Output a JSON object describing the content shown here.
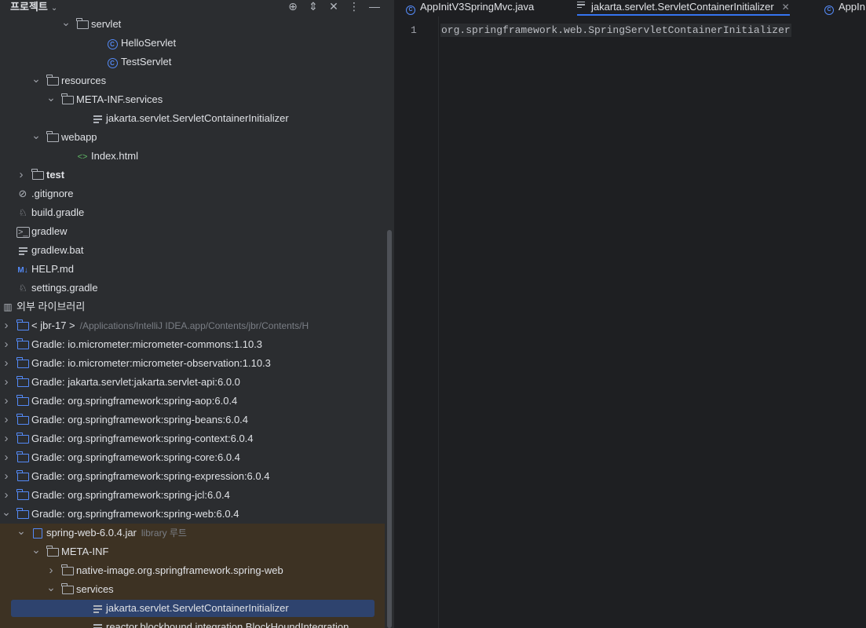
{
  "sidebar": {
    "title": "프로젝트",
    "title_chevron": "⌄",
    "toolbar_icons": [
      "⊕",
      "⇕",
      "✕",
      "⋮",
      "—"
    ]
  },
  "tree": [
    {
      "label": "servlet",
      "level": 7,
      "arrow": "expanded",
      "icon": "package-icon"
    },
    {
      "label": "HelloServlet",
      "level": 9,
      "arrow": "none",
      "icon": "class-icon"
    },
    {
      "label": "TestServlet",
      "level": 9,
      "arrow": "none",
      "icon": "class-icon"
    },
    {
      "label": "resources",
      "level": 5,
      "arrow": "expanded",
      "icon": "resources-folder-icon"
    },
    {
      "label": "META-INF.services",
      "level": 6,
      "arrow": "expanded",
      "icon": "folder-icon"
    },
    {
      "label": "jakarta.servlet.ServletContainerInitializer",
      "level": 8,
      "arrow": "none",
      "icon": "text-file-icon"
    },
    {
      "label": "webapp",
      "level": 5,
      "arrow": "expanded",
      "icon": "folder-icon"
    },
    {
      "label": "Index.html",
      "level": 7,
      "arrow": "none",
      "icon": "html-icon"
    },
    {
      "label": "test",
      "level": 4,
      "arrow": "collapsed",
      "icon": "folder-icon",
      "bold": true
    },
    {
      "label": ".gitignore",
      "level": 3,
      "arrow": "none",
      "icon": "ignore-icon"
    },
    {
      "label": "build.gradle",
      "level": 3,
      "arrow": "none",
      "icon": "gradle-icon"
    },
    {
      "label": "gradlew",
      "level": 3,
      "arrow": "none",
      "icon": "shell-icon"
    },
    {
      "label": "gradlew.bat",
      "level": 3,
      "arrow": "none",
      "icon": "text-file-icon"
    },
    {
      "label": "HELP.md",
      "level": 3,
      "arrow": "none",
      "icon": "markdown-icon"
    },
    {
      "label": "settings.gradle",
      "level": 3,
      "arrow": "none",
      "icon": "gradle-icon"
    },
    {
      "label": "외부 라이브러리",
      "level": 2,
      "arrow": "expanded",
      "icon": "libraries-icon"
    },
    {
      "label": "< jbr-17 >",
      "level": 3,
      "arrow": "collapsed",
      "icon": "jdk-icon",
      "hint": "/Applications/IntelliJ IDEA.app/Contents/jbr/Contents/H"
    },
    {
      "label": "Gradle: io.micrometer:micrometer-commons:1.10.3",
      "level": 3,
      "arrow": "collapsed",
      "icon": "library-folder-icon"
    },
    {
      "label": "Gradle: io.micrometer:micrometer-observation:1.10.3",
      "level": 3,
      "arrow": "collapsed",
      "icon": "library-folder-icon"
    },
    {
      "label": "Gradle: jakarta.servlet:jakarta.servlet-api:6.0.0",
      "level": 3,
      "arrow": "collapsed",
      "icon": "library-folder-icon"
    },
    {
      "label": "Gradle: org.springframework:spring-aop:6.0.4",
      "level": 3,
      "arrow": "collapsed",
      "icon": "library-folder-icon"
    },
    {
      "label": "Gradle: org.springframework:spring-beans:6.0.4",
      "level": 3,
      "arrow": "collapsed",
      "icon": "library-folder-icon"
    },
    {
      "label": "Gradle: org.springframework:spring-context:6.0.4",
      "level": 3,
      "arrow": "collapsed",
      "icon": "library-folder-icon"
    },
    {
      "label": "Gradle: org.springframework:spring-core:6.0.4",
      "level": 3,
      "arrow": "collapsed",
      "icon": "library-folder-icon"
    },
    {
      "label": "Gradle: org.springframework:spring-expression:6.0.4",
      "level": 3,
      "arrow": "collapsed",
      "icon": "library-folder-icon"
    },
    {
      "label": "Gradle: org.springframework:spring-jcl:6.0.4",
      "level": 3,
      "arrow": "collapsed",
      "icon": "library-folder-icon"
    },
    {
      "label": "Gradle: org.springframework:spring-web:6.0.4",
      "level": 3,
      "arrow": "expanded",
      "icon": "library-folder-icon"
    },
    {
      "label": "spring-web-6.0.4.jar",
      "level": 4,
      "arrow": "expanded",
      "icon": "jar-icon",
      "hint": "library 루트",
      "lib": true
    },
    {
      "label": "META-INF",
      "level": 5,
      "arrow": "expanded",
      "icon": "folder-icon",
      "lib": true
    },
    {
      "label": "native-image.org.springframework.spring-web",
      "level": 6,
      "arrow": "collapsed",
      "icon": "folder-icon",
      "lib": true
    },
    {
      "label": "services",
      "level": 6,
      "arrow": "expanded",
      "icon": "folder-icon",
      "lib": true
    },
    {
      "label": "jakarta.servlet.ServletContainerInitializer",
      "level": 8,
      "arrow": "none",
      "icon": "text-file-icon",
      "lib": true,
      "selected": true
    },
    {
      "label": "reactor.blockhound.integration.BlockHoundIntegration",
      "level": 8,
      "arrow": "none",
      "icon": "text-file-icon",
      "lib": true
    }
  ],
  "tabs": [
    {
      "label": "AppInitV3SpringMvc.java",
      "icon": "class-icon"
    },
    {
      "label": "jakarta.servlet.ServletContainerInitializer",
      "icon": "text-file-icon",
      "active": true,
      "close": "✕"
    },
    {
      "label": "AppIn",
      "icon": "class-icon"
    }
  ],
  "editor": {
    "line_number": "1",
    "code": "org.springframework.web.SpringServletContainerInitializer"
  }
}
